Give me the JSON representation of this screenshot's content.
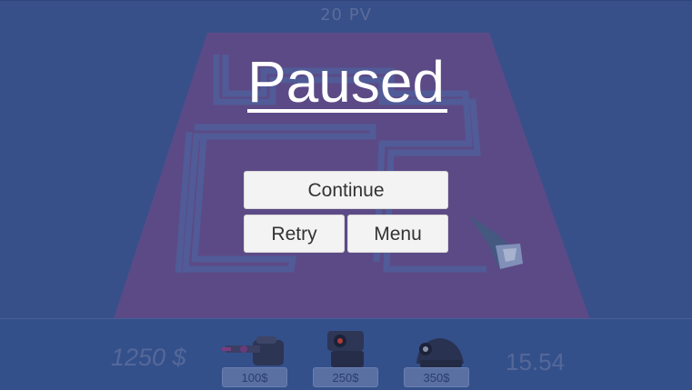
{
  "hud": {
    "hp_label": "20 PV",
    "money": "1250 $",
    "timer": "15.54"
  },
  "shop": {
    "towers": [
      {
        "icon": "laser-tower-icon",
        "price": "100$"
      },
      {
        "icon": "cannon-tower-icon",
        "price": "250$"
      },
      {
        "icon": "mortar-tower-icon",
        "price": "350$"
      }
    ]
  },
  "pause_menu": {
    "title": "Paused",
    "continue_label": "Continue",
    "retry_label": "Retry",
    "menu_label": "Menu"
  },
  "colors": {
    "background": "#37508a",
    "board": "#5c4a86",
    "path": "#4a5c97",
    "button": "#f3f3f3",
    "title": "#ffffff"
  }
}
